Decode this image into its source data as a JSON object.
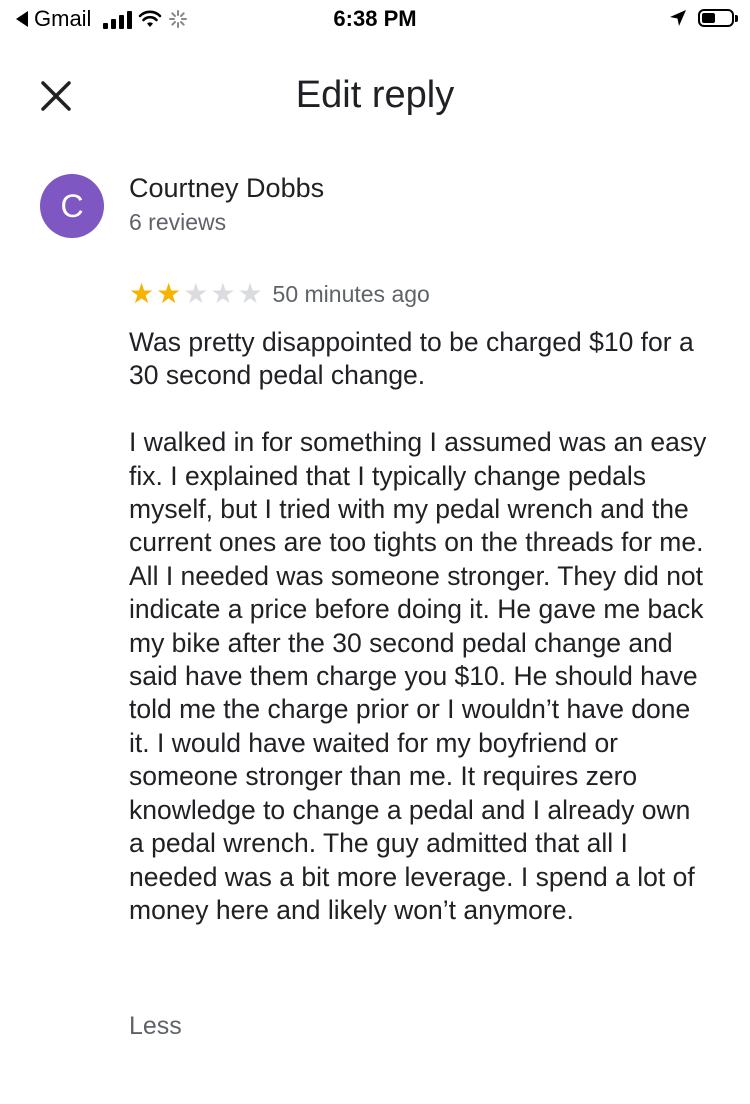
{
  "status_bar": {
    "back_app": "Gmail",
    "time": "6:38 PM",
    "battery_level": 0.45
  },
  "header": {
    "title": "Edit reply",
    "close_icon": "close-icon"
  },
  "review": {
    "avatar_initial": "C",
    "avatar_color": "#7e57c2",
    "reviewer_name": "Courtney Dobbs",
    "reviewer_meta": "6 reviews",
    "rating": 2,
    "rating_max": 5,
    "time_ago": "50 minutes ago",
    "text": "Was pretty disappointed to be charged $10 for a 30 second pedal change.\n\nI walked in for something I assumed was an easy fix. I explained that I typically change pedals myself, but I tried with my pedal wrench and the current ones are too tights on the threads for me. All I needed was someone stronger. They did not indicate a price before doing it. He gave me back my bike after the 30 second pedal change and said have them charge you $10. He should have told me the charge prior or I wouldn’t have done it. I would have waited for my boyfriend or someone stronger than me. It requires zero knowledge to change a pedal and I already own a pedal wrench. The guy admitted that all I needed was a bit more leverage. I  spend a lot of money here and likely won’t anymore.",
    "less_label": "Less"
  },
  "colors": {
    "star_filled": "#f4b400",
    "star_empty": "#dadce0"
  }
}
